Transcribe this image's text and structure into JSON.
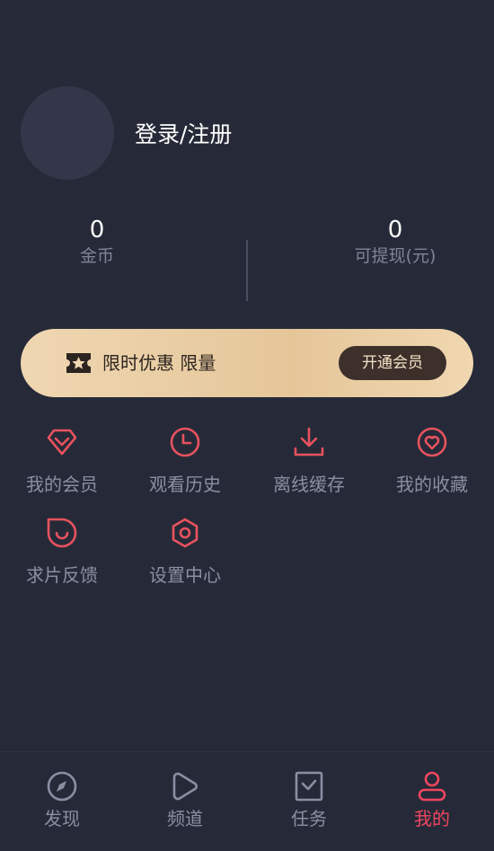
{
  "profile": {
    "login_label": "登录/注册"
  },
  "stats": {
    "coins_value": "0",
    "coins_label": "金币",
    "cash_value": "0",
    "cash_label": "可提现(元)"
  },
  "vip_banner": {
    "text": "限时优惠 限量",
    "button_label": "开通会员",
    "icon": "ticket-star-icon"
  },
  "menu": {
    "items": [
      {
        "label": "我的会员",
        "icon": "diamond-icon"
      },
      {
        "label": "观看历史",
        "icon": "clock-icon"
      },
      {
        "label": "离线缓存",
        "icon": "download-icon"
      },
      {
        "label": "我的收藏",
        "icon": "heart-icon"
      },
      {
        "label": "求片反馈",
        "icon": "feedback-bubble-icon"
      },
      {
        "label": "设置中心",
        "icon": "settings-hexagon-icon"
      }
    ]
  },
  "tabbar": {
    "items": [
      {
        "label": "发现",
        "icon": "compass-icon",
        "active": false
      },
      {
        "label": "频道",
        "icon": "play-icon",
        "active": false
      },
      {
        "label": "任务",
        "icon": "task-check-icon",
        "active": false
      },
      {
        "label": "我的",
        "icon": "user-icon",
        "active": true
      }
    ]
  },
  "colors": {
    "background": "#262a38",
    "accent": "#f0455f",
    "icon_red": "#e8525e",
    "muted_text": "#8a8ea2",
    "gold_banner": "#e8cca2"
  }
}
